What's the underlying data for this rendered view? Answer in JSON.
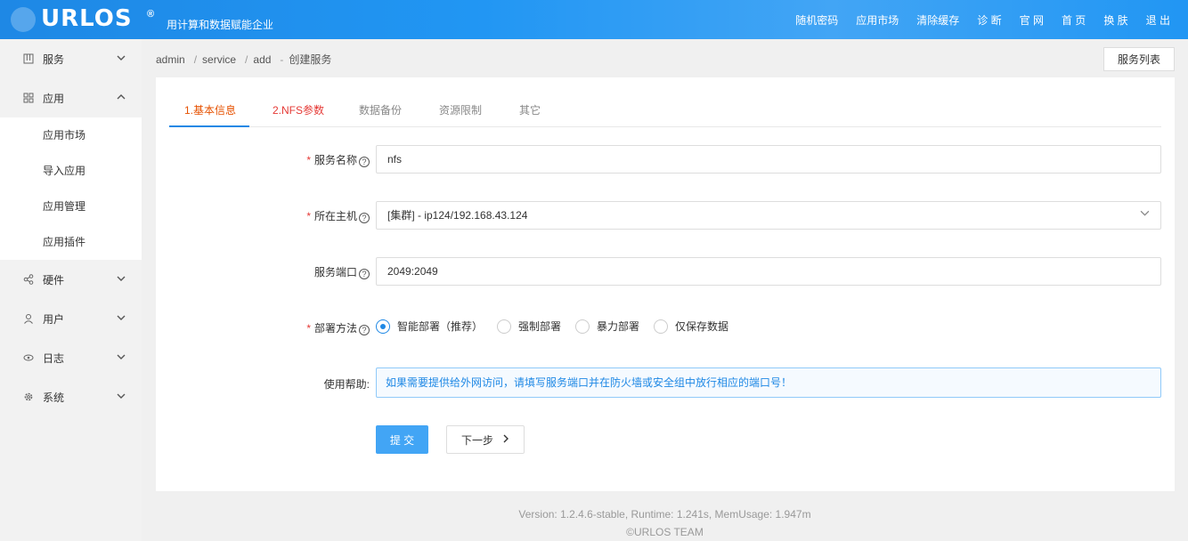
{
  "header": {
    "logo": "URLOS",
    "logo_mark": "®",
    "slogan": "用计算和数据赋能企业",
    "nav": [
      "随机密码",
      "应用市场",
      "清除缓存",
      "诊 断",
      "官 网",
      "首 页",
      "换 肤",
      "退 出"
    ]
  },
  "sidebar": {
    "items": [
      {
        "label": "服务",
        "icon": "grid-icon",
        "chevron": "⌄"
      },
      {
        "label": "应用",
        "icon": "apps-icon",
        "chevron": "⌃"
      },
      {
        "label": "硬件",
        "icon": "share-icon",
        "chevron": "⌄"
      },
      {
        "label": "用户",
        "icon": "user-icon",
        "chevron": "⌄"
      },
      {
        "label": "日志",
        "icon": "eye-icon",
        "chevron": "⌄"
      },
      {
        "label": "系统",
        "icon": "gear-icon",
        "chevron": "⌄"
      }
    ],
    "submenu": [
      "应用市场",
      "导入应用",
      "应用管理",
      "应用插件"
    ]
  },
  "breadcrumb": {
    "parts": [
      "admin",
      "service",
      "add"
    ],
    "current": "创建服务"
  },
  "list_button": "服务列表",
  "tabs": [
    "1.基本信息",
    "2.NFS参数",
    "数据备份",
    "资源限制",
    "其它"
  ],
  "form": {
    "service_name": {
      "label": "服务名称",
      "value": "nfs"
    },
    "host": {
      "label": "所在主机",
      "value": "[集群] - ip124/192.168.43.124"
    },
    "port": {
      "label": "服务端口",
      "value": "2049:2049"
    },
    "deploy": {
      "label": "部署方法",
      "options": [
        "智能部署（推荐）",
        "强制部署",
        "暴力部署",
        "仅保存数据"
      ],
      "selected": 0
    },
    "help": {
      "label": "使用帮助:",
      "text": "如果需要提供给外网访问，请填写服务端口并在防火墙或安全组中放行相应的端口号！"
    }
  },
  "buttons": {
    "submit": "提 交",
    "next": "下一步"
  },
  "footer": {
    "line1": "Version: 1.2.4.6-stable,   Runtime: 1.241s,   MemUsage: 1.947m",
    "line2": "©URLOS TEAM"
  },
  "colors": {
    "brand": "#1e88e5",
    "required": "#e53935"
  }
}
